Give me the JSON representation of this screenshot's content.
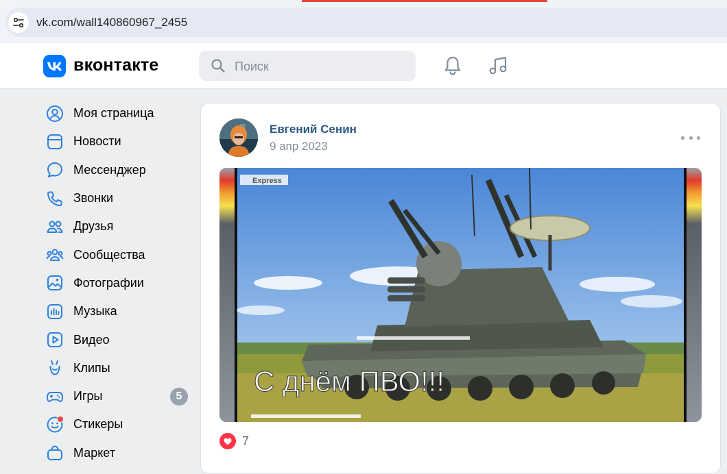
{
  "browser": {
    "url": "vk.com/wall140860967_2455"
  },
  "header": {
    "logo_text": "вконтакте",
    "search_placeholder": "Поиск",
    "accent": "#0077ff"
  },
  "sidebar": {
    "items": [
      {
        "label": "Моя страница",
        "icon": "user-circle-icon"
      },
      {
        "label": "Новости",
        "icon": "news-icon"
      },
      {
        "label": "Мессенджер",
        "icon": "message-icon"
      },
      {
        "label": "Звонки",
        "icon": "phone-icon"
      },
      {
        "label": "Друзья",
        "icon": "friends-icon"
      },
      {
        "label": "Сообщества",
        "icon": "communities-icon"
      },
      {
        "label": "Фотографии",
        "icon": "photo-icon"
      },
      {
        "label": "Музыка",
        "icon": "music-icon"
      },
      {
        "label": "Видео",
        "icon": "video-icon"
      },
      {
        "label": "Клипы",
        "icon": "clips-icon"
      },
      {
        "label": "Игры",
        "icon": "games-icon",
        "badge": "5"
      },
      {
        "label": "Стикеры",
        "icon": "stickers-icon"
      },
      {
        "label": "Маркет",
        "icon": "market-icon"
      }
    ]
  },
  "post": {
    "author": "Евгений Сенин",
    "date": "9 апр 2023",
    "image": {
      "watermark": "Express",
      "caption": "С днём ПВО!!!"
    },
    "likes": "7"
  }
}
